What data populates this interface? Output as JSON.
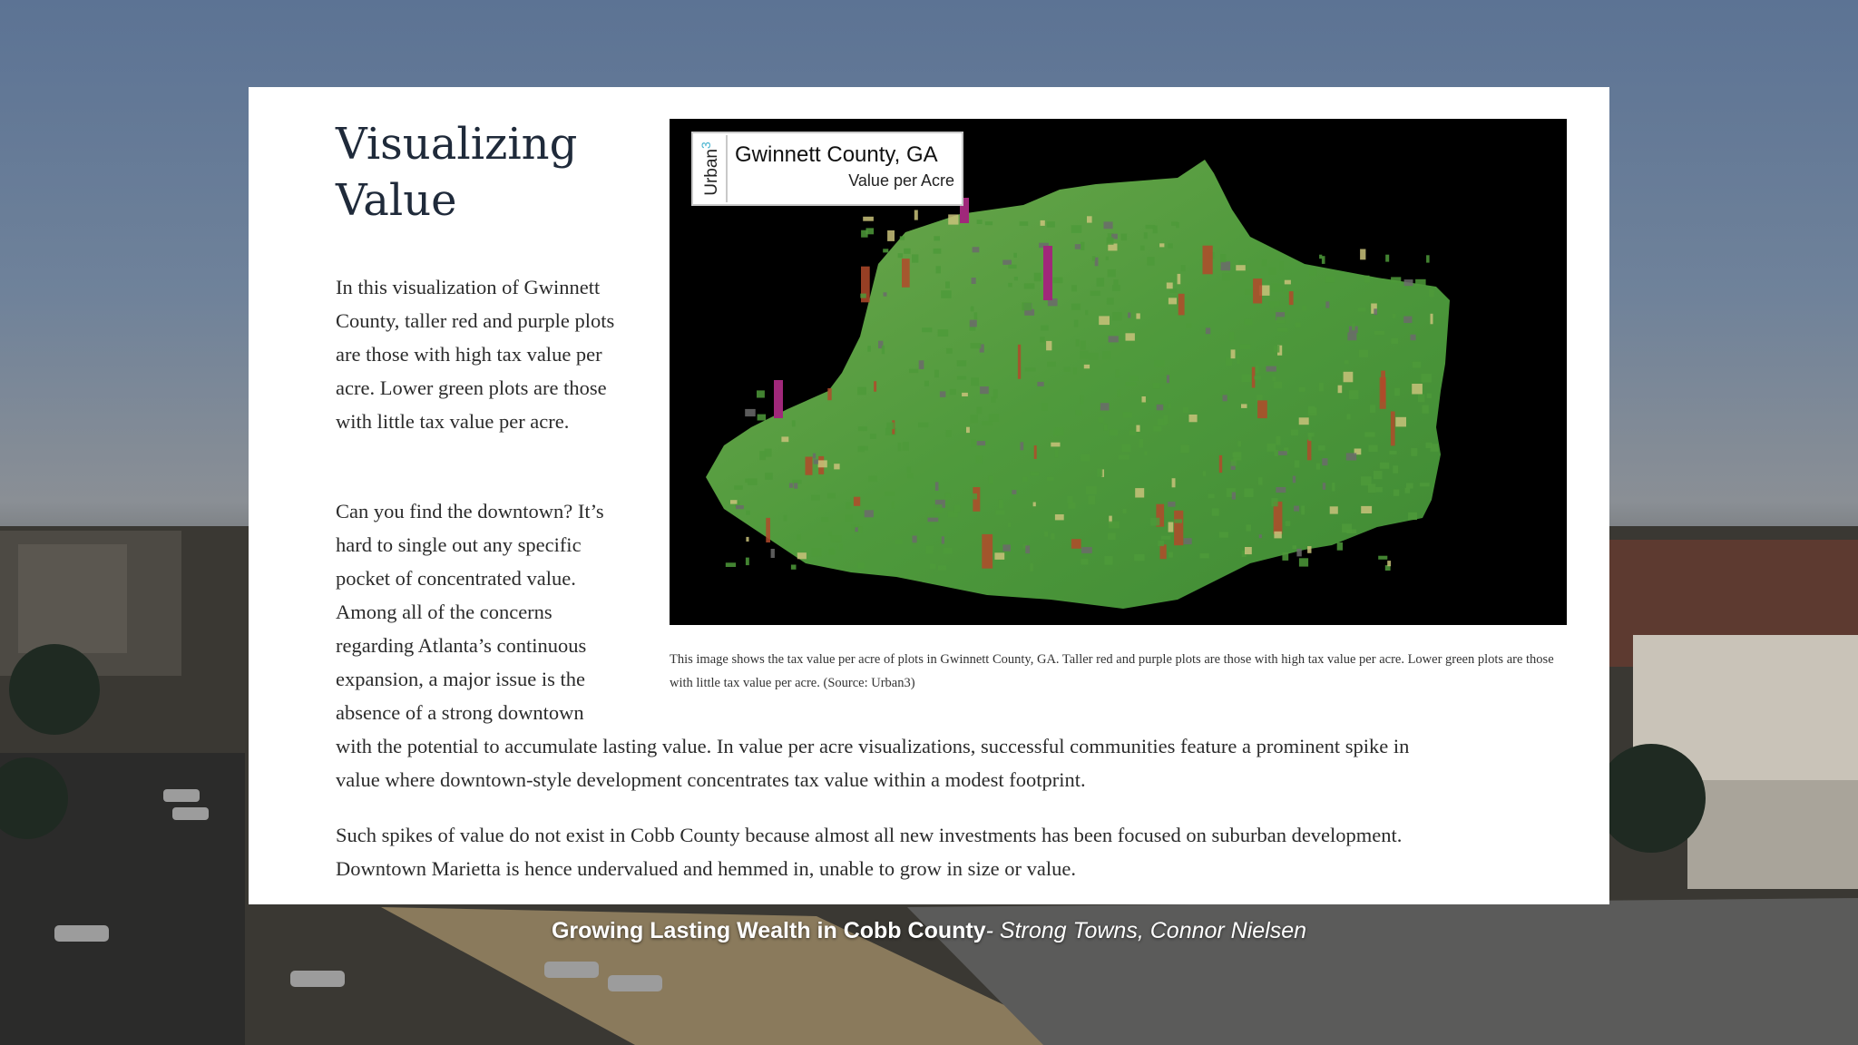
{
  "article": {
    "title": "Visualizing Value",
    "paragraph1": "In this visualization of Gwinnett County, taller red and purple plots are those with high tax value per acre. Lower green plots are those with little tax value per acre.",
    "paragraph2_start": "Can you find the downtown? It’s hard to single out any specific pocket of concentrated value. Among all of the concerns regarding Atlanta’s continuous expansion, a major issue is the absence of a strong downtown",
    "paragraph2_end": "with the potential to accumulate lasting value. In value per acre visualizations, successful communities feature a prominent spike in value where downtown-style development concentrates tax value within a modest footprint.",
    "paragraph3": "Such spikes of value do not exist in Cobb County because almost all new investments has been focused on suburban development. Downtown Marietta is hence undervalued and hemmed in, unable to grow in size or value."
  },
  "figure": {
    "brand": "Urban",
    "brand_superscript": "3",
    "title": "Gwinnett County, GA",
    "subtitle": "Value per Acre",
    "caption": "This image shows the tax value per acre of plots in Gwinnett County, GA. Taller red and purple plots are those with high tax value per acre. Lower green plots are those with little tax value per acre. (Source: Urban3)",
    "colors": {
      "low": "#4e9a3a",
      "mid": "#c9c27a",
      "high": "#b24a2a",
      "highest": "#a0287a",
      "road": "#6b6b6b"
    }
  },
  "credit": {
    "title": "Growing Lasting Wealth in Cobb County",
    "separator": "-",
    "source": " Strong Towns, Connor Nielsen"
  }
}
